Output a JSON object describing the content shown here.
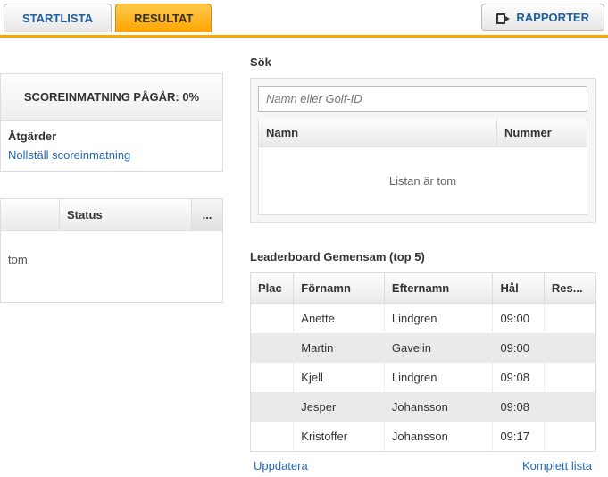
{
  "tabs": {
    "startlist": "STARTLISTA",
    "result": "RESULTAT"
  },
  "reports_button": "RAPPORTER",
  "score_panel": {
    "title": "SCOREINMATNING PÅGÅR: 0%",
    "actions_heading": "Åtgärder",
    "reset_link": "Nollställ scoreinmatning"
  },
  "status_panel": {
    "col_status": "Status",
    "more": "...",
    "empty": "tom"
  },
  "search": {
    "heading": "Sök",
    "placeholder": "Namn eller Golf-ID",
    "col_name": "Namn",
    "col_number": "Nummer",
    "empty": "Listan är tom"
  },
  "leaderboard": {
    "heading": "Leaderboard Gemensam (top 5)",
    "cols": {
      "plac": "Plac",
      "first": "Förnamn",
      "last": "Efternamn",
      "hal": "Hål",
      "res": "Res..."
    },
    "rows": [
      {
        "plac": "",
        "first": "Anette",
        "last": "Lindgren",
        "hal": "09:00",
        "res": ""
      },
      {
        "plac": "",
        "first": "Martin",
        "last": "Gavelin",
        "hal": "09:00",
        "res": ""
      },
      {
        "plac": "",
        "first": "Kjell",
        "last": "Lindgren",
        "hal": "09:08",
        "res": ""
      },
      {
        "plac": "",
        "first": "Jesper",
        "last": "Johansson",
        "hal": "09:08",
        "res": ""
      },
      {
        "plac": "",
        "first": "Kristoffer",
        "last": "Johansson",
        "hal": "09:17",
        "res": ""
      }
    ],
    "update": "Uppdatera",
    "full_list": "Komplett lista"
  }
}
